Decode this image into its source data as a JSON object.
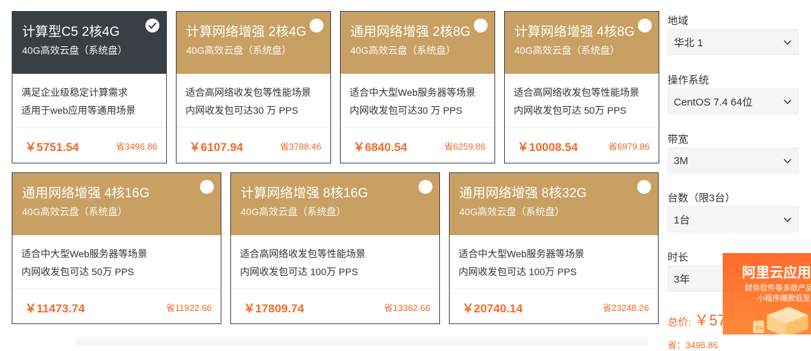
{
  "currency": "￥",
  "save_prefix": "省",
  "cards": [
    {
      "title": "计算型C5 2核4G",
      "disk": "40G高效云盘（系统盘）",
      "line1": "满足企业级稳定计算需求",
      "line2": "适用于web应用等通用场景",
      "price": "￥5751.54",
      "save": "省3496.86",
      "selected": true
    },
    {
      "title": "计算网络增强 2核4G",
      "disk": "40G高效云盘（系统盘）",
      "line1": "适合高网络收发包等性能场景",
      "line2": "内网收发包可达30 万 PPS",
      "price": "￥6107.94",
      "save": "省3788.46",
      "selected": false
    },
    {
      "title": "通用网络增强 2核8G",
      "disk": "40G高效云盘（系统盘）",
      "line1": "适合中大型Web服务器等场景",
      "line2": "内网收发包可达30 万 PPS",
      "price": "￥6840.54",
      "save": "省6259.86",
      "selected": false
    },
    {
      "title": "计算网络增强 4核8G",
      "disk": "40G高效云盘（系统盘）",
      "line1": "适合高网络收发包等性能场景",
      "line2": "内网收发包可达 50万 PPS",
      "price": "￥10008.54",
      "save": "省6979.86",
      "selected": false
    },
    {
      "title": "通用网络增强 4核16G",
      "disk": "40G高效云盘（系统盘）",
      "line1": "适合中大型Web服务器等场景",
      "line2": "内网收发包可达 50万 PPS",
      "price": "￥11473.74",
      "save": "省11922.66",
      "selected": false
    },
    {
      "title": "计算网络增强 8核16G",
      "disk": "40G高效云盘（系统盘）",
      "line1": "适合高网络收发包等性能场景",
      "line2": "内网收发包可达 100万 PPS",
      "price": "￥17809.74",
      "save": "省13362.66",
      "selected": false
    },
    {
      "title": "通用网络增强 8核32G",
      "disk": "40G高效云盘（系统盘）",
      "line1": "适合中大型Web服务器等场景",
      "line2": "内网收发包可达 100万 PPS",
      "price": "￥20740.14",
      "save": "省23248.26",
      "selected": false
    }
  ],
  "form": {
    "region": {
      "label": "地域",
      "value": "华北 1"
    },
    "os": {
      "label": "操作系统",
      "value": "CentOS 7.4 64位"
    },
    "bandwidth": {
      "label": "带宽",
      "value": "3M"
    },
    "count": {
      "label": "台数（限3台）",
      "value": "1台"
    },
    "duration": {
      "label": "时长",
      "value": "3年"
    }
  },
  "total": {
    "label": "总价:",
    "value": "￥57"
  },
  "saving_text": "省：3496.86",
  "promo": {
    "title": "阿里云应用",
    "line1": "财务软件等多款产品",
    "line2": "小程序爆款低至"
  },
  "colors": {
    "accent": "#c9a063",
    "selected": "#3a3f45",
    "price": "#f26b2b",
    "promo": "#ff6a2a"
  },
  "icons": {
    "selected": "check-icon",
    "dropdown": "chevron-down-icon"
  }
}
